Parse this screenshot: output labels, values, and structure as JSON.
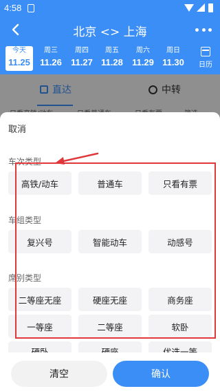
{
  "status_bar": {
    "time": "4:58"
  },
  "header": {
    "title": "北京 <> 上海"
  },
  "date_strip": {
    "days": [
      {
        "weekday": "今天",
        "date": "11.25",
        "active": true
      },
      {
        "weekday": "周三",
        "date": "11.26"
      },
      {
        "weekday": "周四",
        "date": "11.27"
      },
      {
        "weekday": "周五",
        "date": "11.28"
      },
      {
        "weekday": "周六",
        "date": "11.29"
      },
      {
        "weekday": "周日",
        "date": "11.30"
      }
    ],
    "calendar_label": "日历"
  },
  "tabs": {
    "direct": "直达",
    "transfer": "中转"
  },
  "filters": [
    "只看高铁/动车",
    "只看普通车",
    "只看有票",
    "筛选"
  ],
  "sheet": {
    "cancel": "取消",
    "sections": [
      {
        "title": "车次类型",
        "options": [
          "高铁/动车",
          "普通车",
          "只看有票"
        ]
      },
      {
        "title": "车组类型",
        "options": [
          "复兴号",
          "智能动车",
          "动感号"
        ]
      },
      {
        "title": "席别类型",
        "options": [
          "二等座无座",
          "硬座无座",
          "商务座",
          "一等座",
          "二等座",
          "软卧",
          "硬卧",
          "硬座",
          "优选一等"
        ]
      }
    ],
    "clear_label": "清空",
    "confirm_label": "确认"
  },
  "colors": {
    "primary": "#3a8ef5",
    "annotation": "#e0373b"
  }
}
